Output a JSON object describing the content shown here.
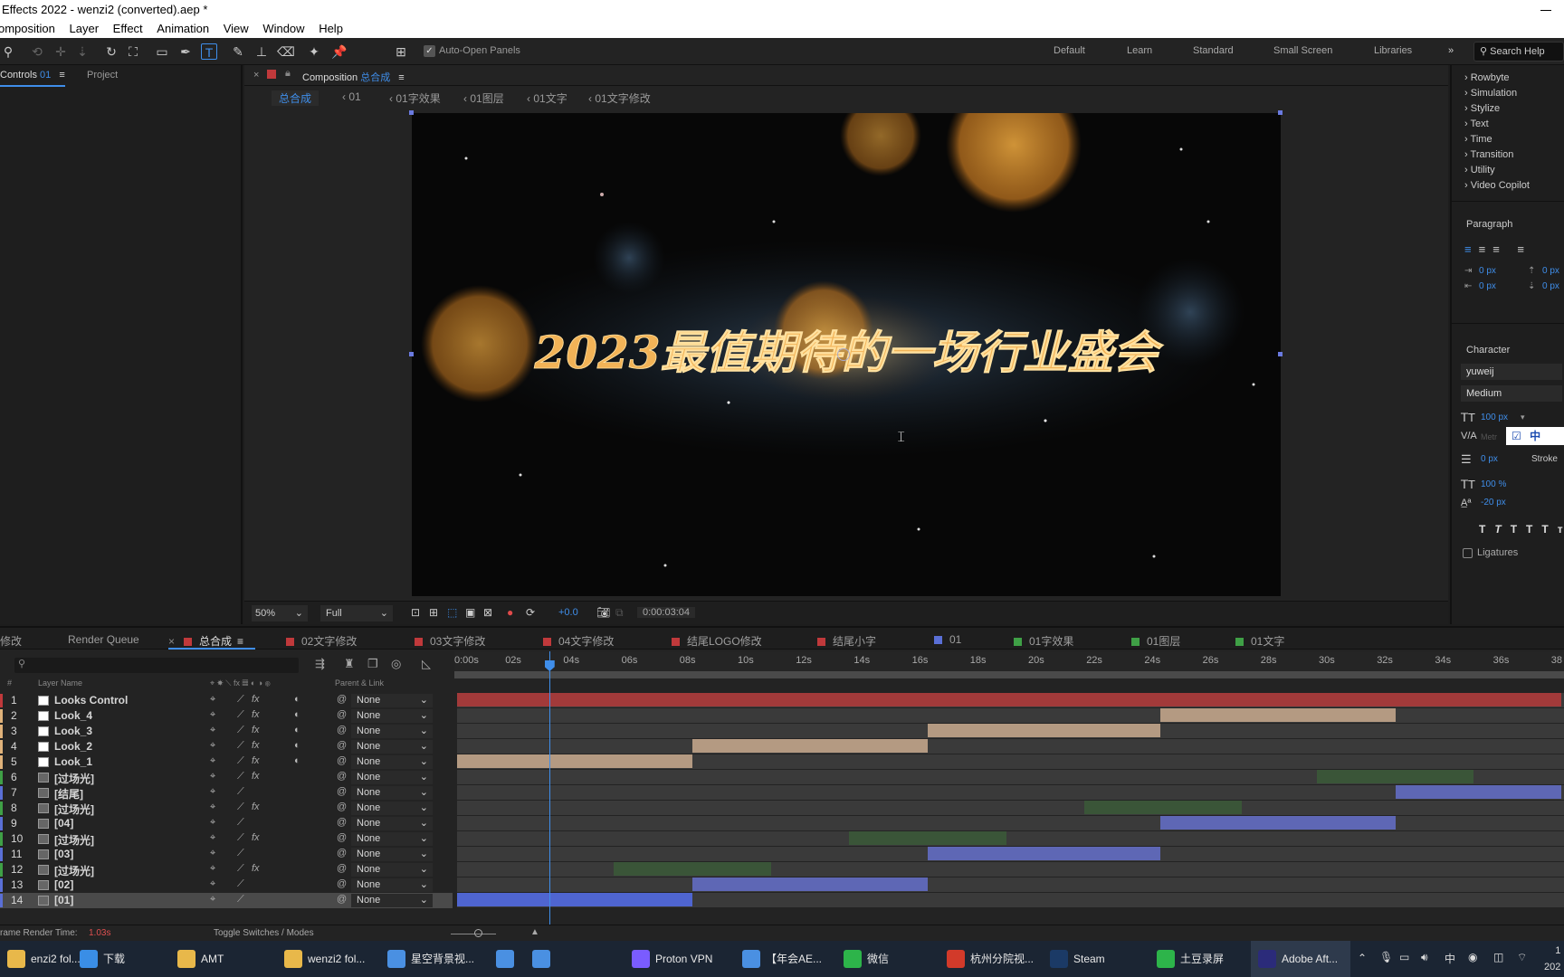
{
  "window": {
    "title": "Effects 2022 - wenzi2 (converted).aep *"
  },
  "menu": [
    "omposition",
    "Layer",
    "Effect",
    "Animation",
    "View",
    "Window",
    "Help"
  ],
  "toolbar": {
    "auto_open_panels": "Auto-Open Panels",
    "workspaces": [
      "Default",
      "Learn",
      "Standard",
      "Small Screen",
      "Libraries"
    ],
    "search_help": "Search Help"
  },
  "left_panel": {
    "tab_controls": "Controls",
    "tab_controls_num": "01",
    "tab_project": "Project"
  },
  "comp_panel": {
    "tab_label": "Composition",
    "tab_name": "总合成",
    "breadcrumbs": [
      "总合成",
      "01",
      "01字效果",
      "01图层",
      "01文字",
      "01文字修改"
    ],
    "zoom": "50%",
    "resolution": "Full",
    "exposure": "+0.0",
    "timecode": "0:00:03:04",
    "title_text": "2023最值期待的一场行业盛会"
  },
  "right_panel": {
    "effects": [
      "Rowbyte",
      "Simulation",
      "Stylize",
      "Text",
      "Time",
      "Transition",
      "Utility",
      "Video Copilot"
    ],
    "paragraph_title": "Paragraph",
    "para_values": [
      "0 px",
      "0 px",
      "0 px",
      "0 px"
    ],
    "character_title": "Character",
    "font": "yuweij",
    "style": "Medium",
    "font_size": "100 px",
    "metrics": "Metr",
    "ime_label": "中",
    "stroke_px": "0 px",
    "stroke_label": "Stroke",
    "vscale": "100 %",
    "baseline": "-20 px",
    "ligatures": "Ligatures",
    "styles": [
      "T",
      "T",
      "TT",
      "Tт"
    ]
  },
  "timeline": {
    "tabs": [
      {
        "label": "修改",
        "color": ""
      },
      {
        "label": "Render Queue",
        "color": ""
      },
      {
        "label": "总合成",
        "color": "#c0393b"
      },
      {
        "label": "02文字修改",
        "color": "#c0393b"
      },
      {
        "label": "03文字修改",
        "color": "#c0393b"
      },
      {
        "label": "04文字修改",
        "color": "#c0393b"
      },
      {
        "label": "结尾LOGO修改",
        "color": "#c0393b"
      },
      {
        "label": "结尾小字",
        "color": "#c0393b"
      },
      {
        "label": "01",
        "color": "#5a6fd6"
      },
      {
        "label": "01字效果",
        "color": "#3fa046"
      },
      {
        "label": "01图层",
        "color": "#3fa046"
      },
      {
        "label": "01文字",
        "color": "#3fa046"
      }
    ],
    "ruler": [
      "0:00s",
      "02s",
      "04s",
      "06s",
      "08s",
      "10s",
      "12s",
      "14s",
      "16s",
      "18s",
      "20s",
      "22s",
      "24s",
      "26s",
      "28s",
      "30s",
      "32s",
      "34s",
      "36s",
      "38"
    ],
    "header_layer_name": "Layer Name",
    "header_parent": "Parent & Link",
    "layers": [
      {
        "num": "1",
        "name": "Looks Control",
        "label": "#c0393b",
        "parent": "None",
        "start": 0,
        "end": 38,
        "color": "#a23a3a",
        "fx": true
      },
      {
        "num": "2",
        "name": "Look_4",
        "label": "#e0b27a",
        "parent": "None",
        "start": 24.2,
        "end": 32.3,
        "color": "#b49a82",
        "fx": true
      },
      {
        "num": "3",
        "name": "Look_3",
        "label": "#e0b27a",
        "parent": "None",
        "start": 16.2,
        "end": 24.2,
        "color": "#b49a82",
        "fx": true
      },
      {
        "num": "4",
        "name": "Look_2",
        "label": "#e0b27a",
        "parent": "None",
        "start": 8.1,
        "end": 16.2,
        "color": "#b49a82",
        "fx": true
      },
      {
        "num": "5",
        "name": "Look_1",
        "label": "#e0b27a",
        "parent": "None",
        "start": 0,
        "end": 8.1,
        "color": "#b49a82",
        "fx": true
      },
      {
        "num": "6",
        "name": "[过场光]",
        "label": "#3fa046",
        "parent": "None",
        "start": 29.6,
        "end": 35,
        "color": "#3a5538",
        "fx": true
      },
      {
        "num": "7",
        "name": "[结尾]",
        "label": "#5a6fd6",
        "parent": "None",
        "start": 32.3,
        "end": 38,
        "color": "#5e67b5",
        "fx": false
      },
      {
        "num": "8",
        "name": "[过场光]",
        "label": "#3fa046",
        "parent": "None",
        "start": 21.6,
        "end": 27,
        "color": "#3a5538",
        "fx": true
      },
      {
        "num": "9",
        "name": "[04]",
        "label": "#5a6fd6",
        "parent": "None",
        "start": 24.2,
        "end": 32.3,
        "color": "#5e67b5",
        "fx": false
      },
      {
        "num": "10",
        "name": "[过场光]",
        "label": "#3fa046",
        "parent": "None",
        "start": 13.5,
        "end": 18.9,
        "color": "#3a5538",
        "fx": true
      },
      {
        "num": "11",
        "name": "[03]",
        "label": "#5a6fd6",
        "parent": "None",
        "start": 16.2,
        "end": 24.2,
        "color": "#5e67b5",
        "fx": false
      },
      {
        "num": "12",
        "name": "[过场光]",
        "label": "#3fa046",
        "parent": "None",
        "start": 5.4,
        "end": 10.8,
        "color": "#3a5538",
        "fx": true
      },
      {
        "num": "13",
        "name": "[02]",
        "label": "#5a6fd6",
        "parent": "None",
        "start": 8.1,
        "end": 16.2,
        "color": "#5e67b5",
        "fx": false
      },
      {
        "num": "14",
        "name": "[01]",
        "label": "#5a6fd6",
        "parent": "None",
        "start": 0,
        "end": 8.1,
        "color": "#4f65d0",
        "fx": false
      }
    ],
    "playhead_seconds": 3.17,
    "status_render_label": "rame Render Time:",
    "status_render_value": "1.03s",
    "toggle_label": "Toggle Switches / Modes"
  },
  "taskbar": {
    "items": [
      {
        "label": "enzi2 fol...",
        "color": "#e8b84a"
      },
      {
        "label": "下载",
        "color": "#3a8ee6"
      },
      {
        "label": "AMT",
        "color": "#e8b84a"
      },
      {
        "label": "wenzi2 fol...",
        "color": "#e8b84a"
      },
      {
        "label": "星空背景视...",
        "color": "#4a90e2"
      },
      {
        "label": "",
        "color": "#4a90e2"
      },
      {
        "label": "",
        "color": "#4a90e2"
      },
      {
        "label": "Proton VPN",
        "color": "#7a5cff"
      },
      {
        "label": "【年会AE...",
        "color": "#4a90e2"
      },
      {
        "label": "微信",
        "color": "#2db44a"
      },
      {
        "label": "杭州分院视...",
        "color": "#d23a2a"
      },
      {
        "label": "Steam",
        "color": "#1b3a66"
      },
      {
        "label": "土豆录屏",
        "color": "#2db44a"
      },
      {
        "label": "Adobe Aft...",
        "color": "#2b2b7a"
      }
    ],
    "tray_ime": "中",
    "clock_time": "1",
    "clock_date": "202"
  }
}
